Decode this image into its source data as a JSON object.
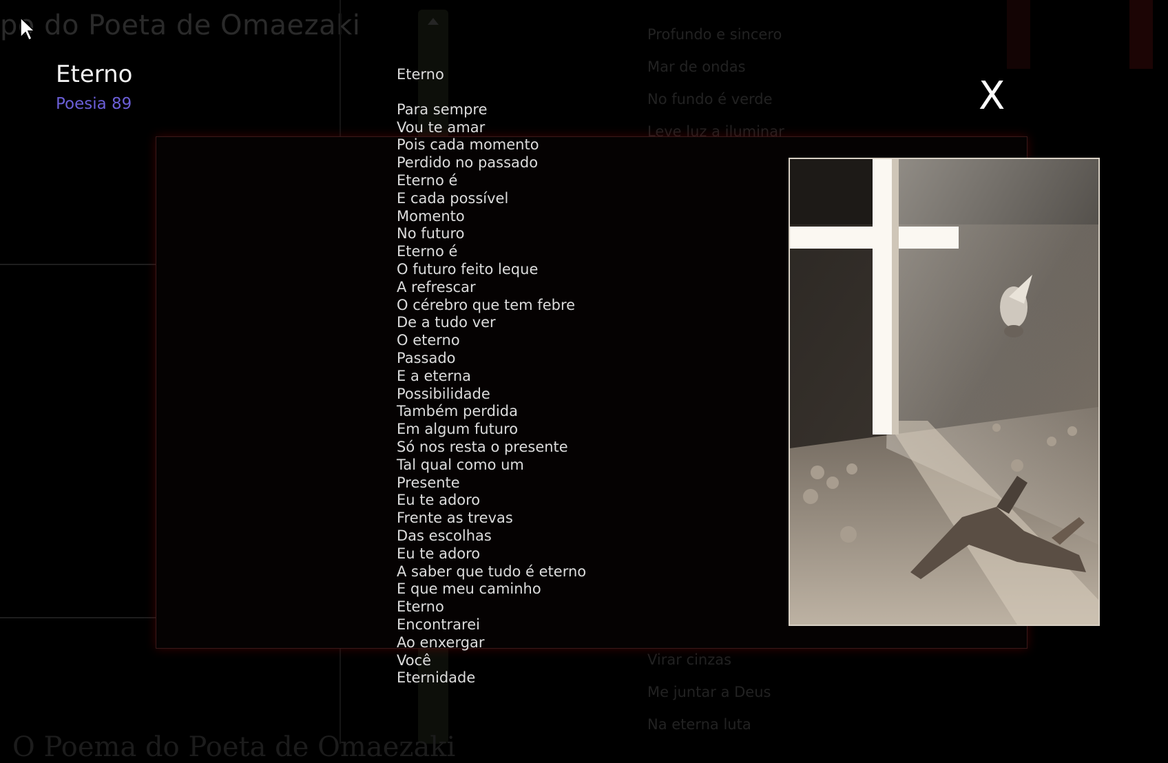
{
  "background": {
    "page_title": "po do Poeta de Omaezaki",
    "list_items_top": [
      "Profundo e sincero",
      "Mar de ondas",
      "No fundo é verde",
      "Leve luz a iluminar"
    ],
    "list_items_bottom": [
      "Virar cinzas",
      "Me juntar a Deus",
      "Na eterna luta"
    ],
    "bottom_text": "O Poema do Poeta de Omaezaki"
  },
  "poem": {
    "heading": "Eterno",
    "number": "Poesia 89",
    "title": "Eterno",
    "lines": [
      "Para sempre",
      "Vou te amar",
      "Pois cada momento",
      "Perdido no passado",
      "Eterno é",
      "E cada possível",
      "Momento",
      "No futuro",
      "Eterno é",
      "O futuro feito leque",
      "A refrescar",
      "O cérebro que tem febre",
      "De a tudo ver",
      "O eterno",
      "Passado",
      "E a eterna",
      "Possibilidade",
      "Também perdida",
      "Em algum futuro",
      "Só nos resta o presente",
      "Tal qual como um",
      "Presente",
      "Eu te adoro",
      "Frente as trevas",
      "Das escolhas",
      "Eu te adoro",
      "A saber que tudo é eterno",
      "E que meu caminho",
      "Eterno",
      "Encontrarei",
      "Ao enxergar",
      "Você",
      "Eternidade"
    ]
  },
  "modal": {
    "close_label": "X"
  },
  "icons": {
    "cursor": "mouse-pointer-icon"
  },
  "colors": {
    "poem_number": "#6b5fd8",
    "modal_glow": "#781010",
    "background": "#000000"
  }
}
